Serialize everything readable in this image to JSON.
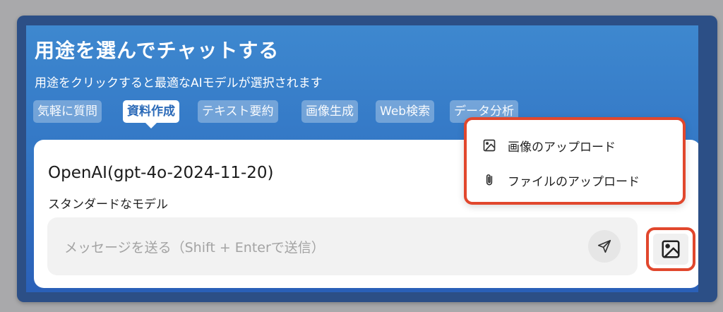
{
  "header": {
    "title": "用途を選んでチャットする",
    "subtitle": "用途をクリックすると最適なAIモデルが選択されます"
  },
  "tabs": [
    {
      "label": "気軽に質問",
      "active": false
    },
    {
      "label": "資料作成",
      "active": true
    },
    {
      "label": "テキスト要約",
      "active": false
    },
    {
      "label": "画像生成",
      "active": false
    },
    {
      "label": "Web検索",
      "active": false
    },
    {
      "label": "データ分析",
      "active": false
    }
  ],
  "model": {
    "name": "OpenAI(gpt-4o-2024-11-20)",
    "description": "スタンダードなモデル"
  },
  "input": {
    "placeholder": "メッセージを送る（Shift + Enterで送信）"
  },
  "upload_menu": {
    "items": [
      {
        "label": "画像のアップロード",
        "icon": "image-icon"
      },
      {
        "label": "ファイルのアップロード",
        "icon": "paperclip-icon"
      }
    ]
  },
  "colors": {
    "accent": "#2b6ab8",
    "highlight_border": "#e1472d",
    "frame": "#2c4f86"
  }
}
